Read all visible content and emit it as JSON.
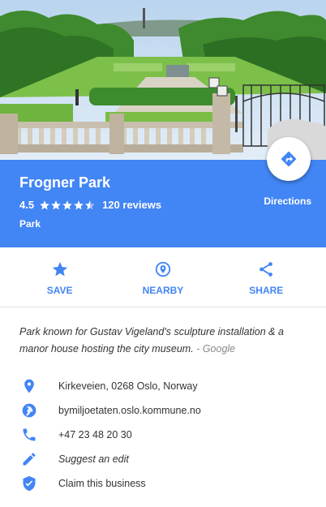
{
  "place": {
    "name": "Frogner Park",
    "rating": "4.5",
    "stars_filled": 4.5,
    "reviews_label": "120 reviews",
    "type": "Park"
  },
  "directions_label": "Directions",
  "actions": {
    "save": "SAVE",
    "nearby": "NEARBY",
    "share": "SHARE"
  },
  "description": {
    "text": "Park known for Gustav Vigeland's sculpture installation & a manor house hosting the city museum.",
    "source": " - Google"
  },
  "info": {
    "address": "Kirkeveien, 0268 Oslo, Norway",
    "website": "bymiljoetaten.oslo.kommune.no",
    "phone": "+47 23 48 20 30",
    "suggest_edit": "Suggest an edit",
    "claim": "Claim this business"
  },
  "colors": {
    "accent": "#4285f4"
  }
}
